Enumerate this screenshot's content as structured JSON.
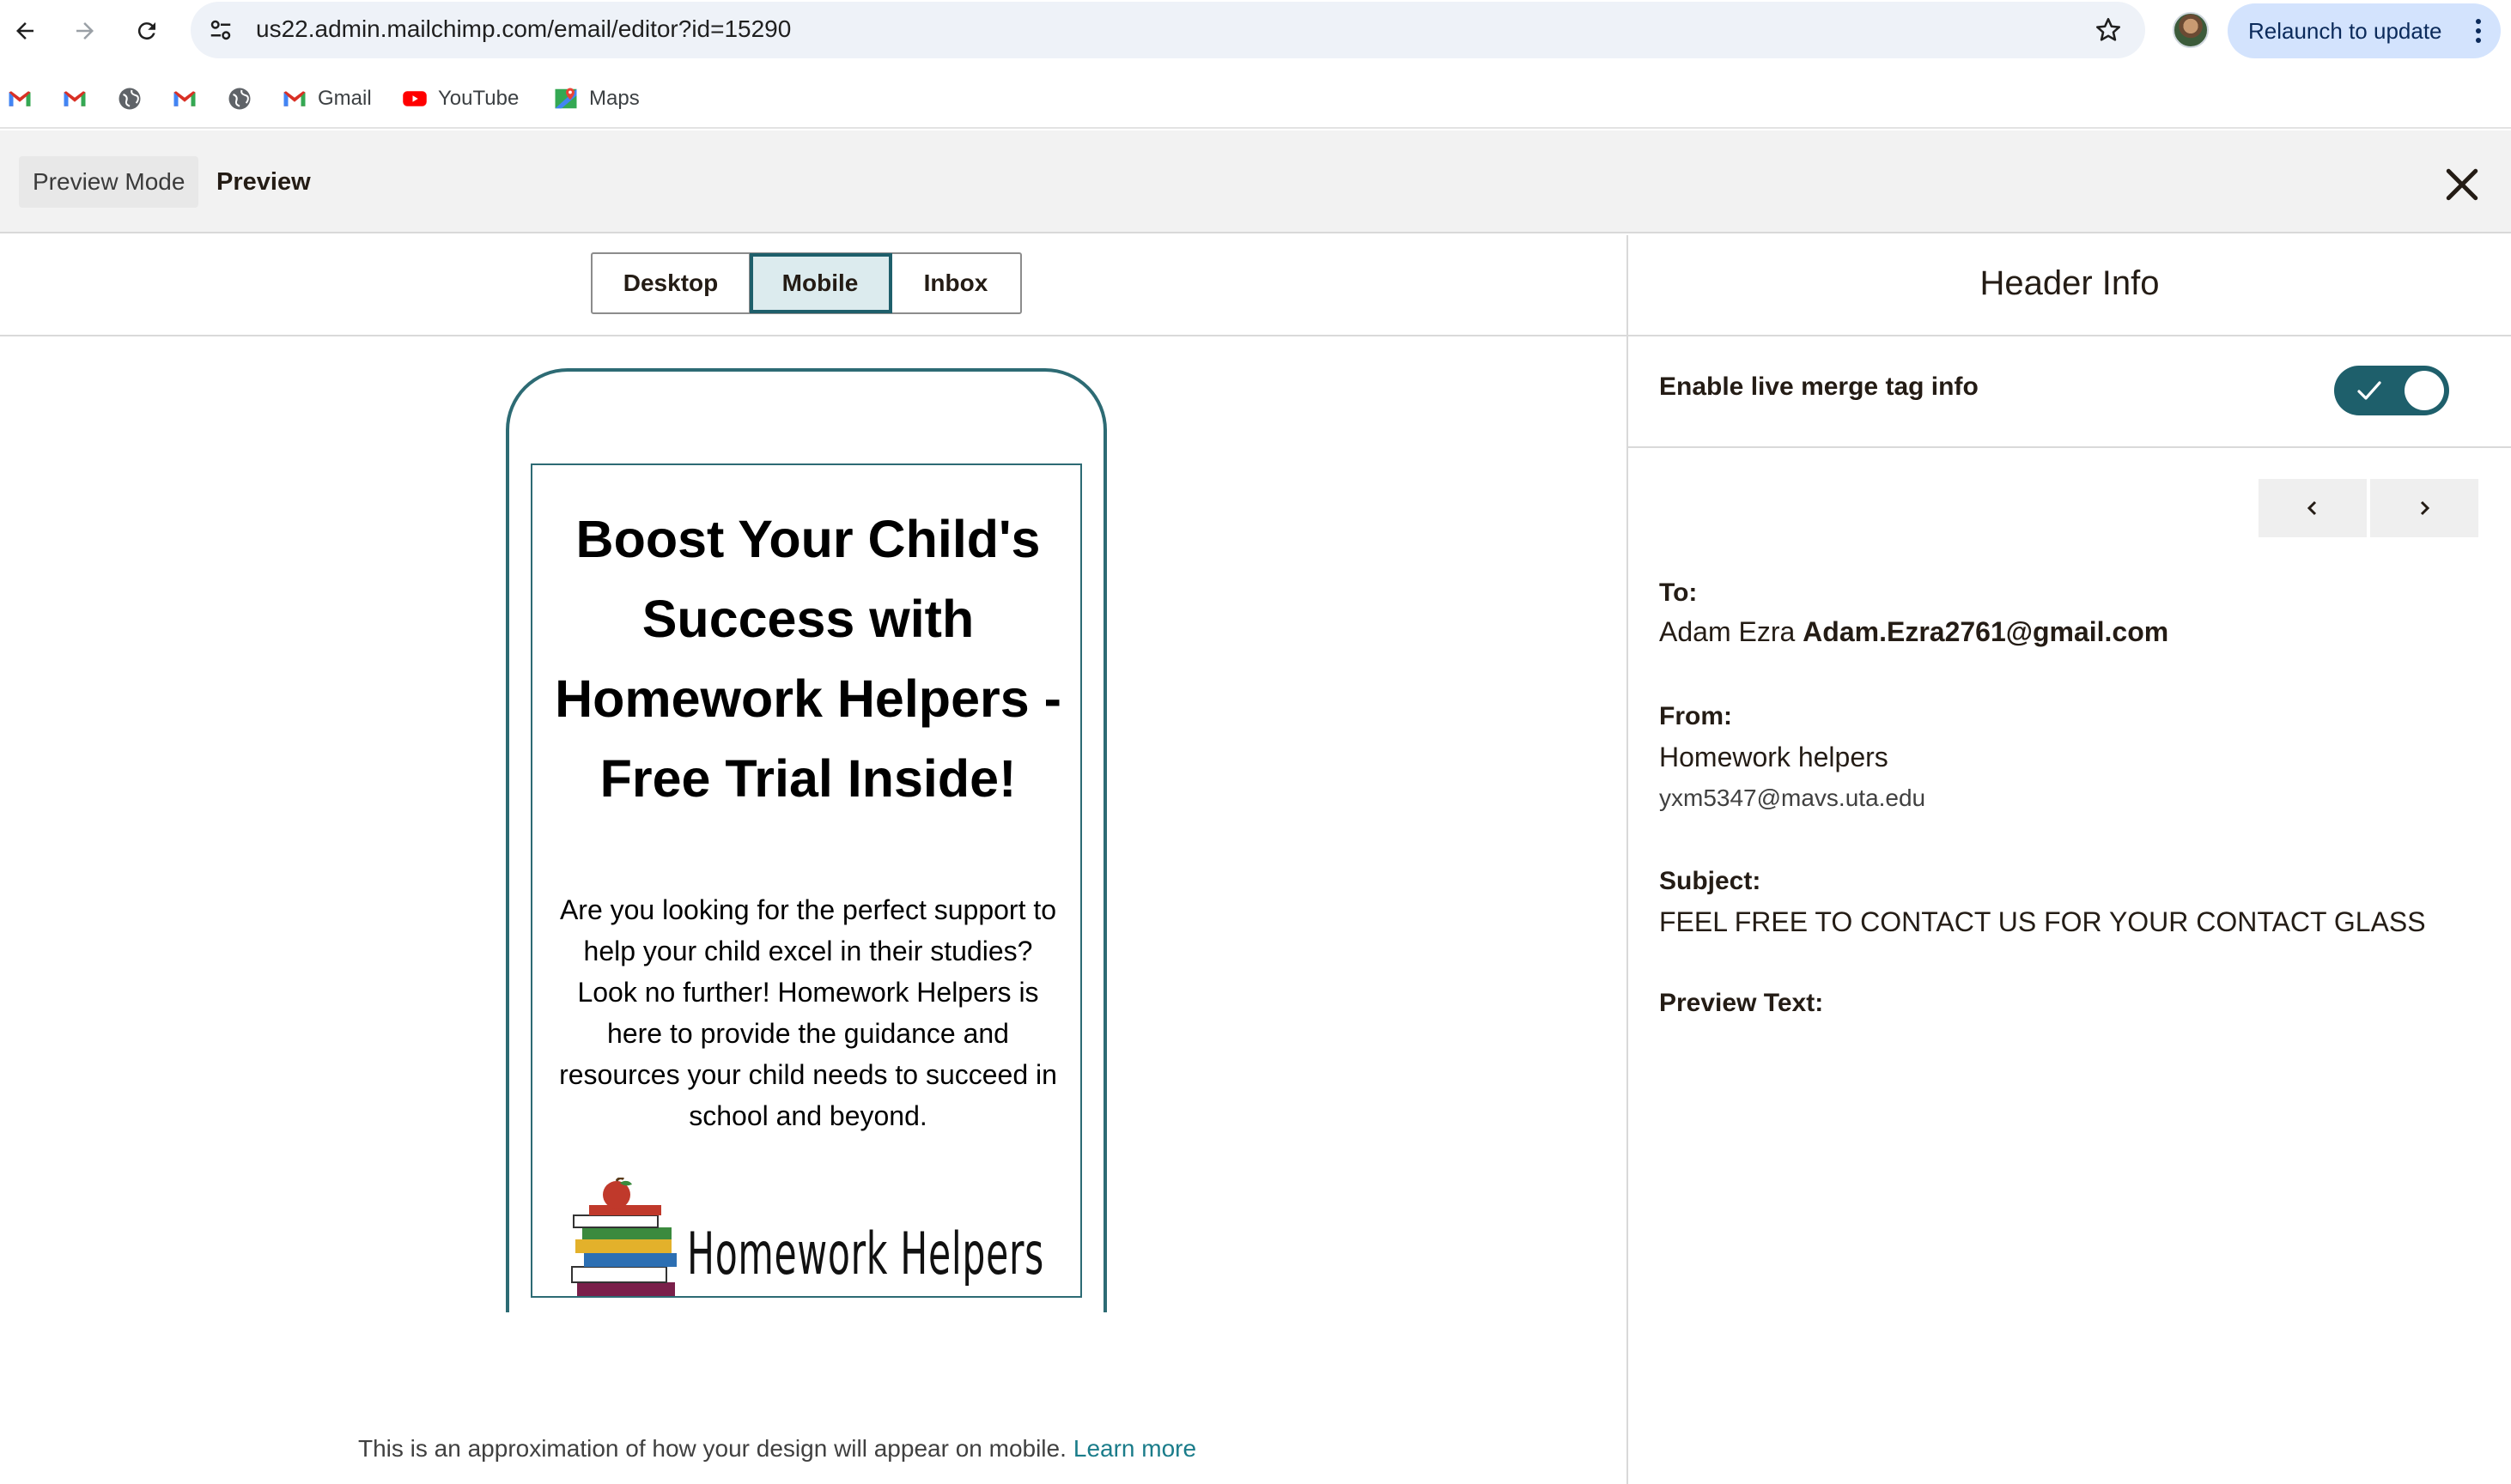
{
  "browser": {
    "url": "us22.admin.mailchimp.com/email/editor?id=15290",
    "relaunch_label": "Relaunch to update",
    "bookmarks": [
      {
        "label": "",
        "icon": "gmail-icon"
      },
      {
        "label": "",
        "icon": "gmail-icon"
      },
      {
        "label": "",
        "icon": "globe-icon"
      },
      {
        "label": "",
        "icon": "gmail-icon"
      },
      {
        "label": "",
        "icon": "globe-icon"
      },
      {
        "label": "Gmail",
        "icon": "gmail-icon"
      },
      {
        "label": "YouTube",
        "icon": "youtube-icon"
      },
      {
        "label": "Maps",
        "icon": "maps-icon"
      }
    ]
  },
  "preview_bar": {
    "mode_label": "Preview Mode",
    "title": "Preview"
  },
  "view_tabs": [
    {
      "label": "Desktop",
      "active": false
    },
    {
      "label": "Mobile",
      "active": true
    },
    {
      "label": "Inbox",
      "active": false
    }
  ],
  "email": {
    "headline": "Boost Your Child's Success with Homework Helpers - Free Trial Inside!",
    "body": "Are you looking for the perfect support to help your child excel in their studies? Look no further! Homework Helpers is here to provide the guidance and resources your child needs to succeed in school and beyond.",
    "logo_text": "Homework Helpers"
  },
  "footnote": {
    "text": "This is an approximation of how your design will appear on mobile.",
    "link": "Learn more"
  },
  "header_info": {
    "title": "Header Info",
    "merge_toggle_label": "Enable live merge tag info",
    "merge_toggle_on": true,
    "to_label": "To:",
    "to_name": "Adam Ezra",
    "to_email": "Adam.Ezra2761@gmail.com",
    "from_label": "From:",
    "from_name": "Homework helpers",
    "from_email": "yxm5347@mavs.uta.edu",
    "subject_label": "Subject:",
    "subject_value": "FEEL FREE TO CONTACT US FOR YOUR CONTACT GLASS",
    "preview_text_label": "Preview Text:",
    "preview_text_value": ""
  },
  "colors": {
    "accent": "#1e5f6b",
    "link": "#1a7c8a",
    "relaunch_bg": "#d3e3fd"
  }
}
